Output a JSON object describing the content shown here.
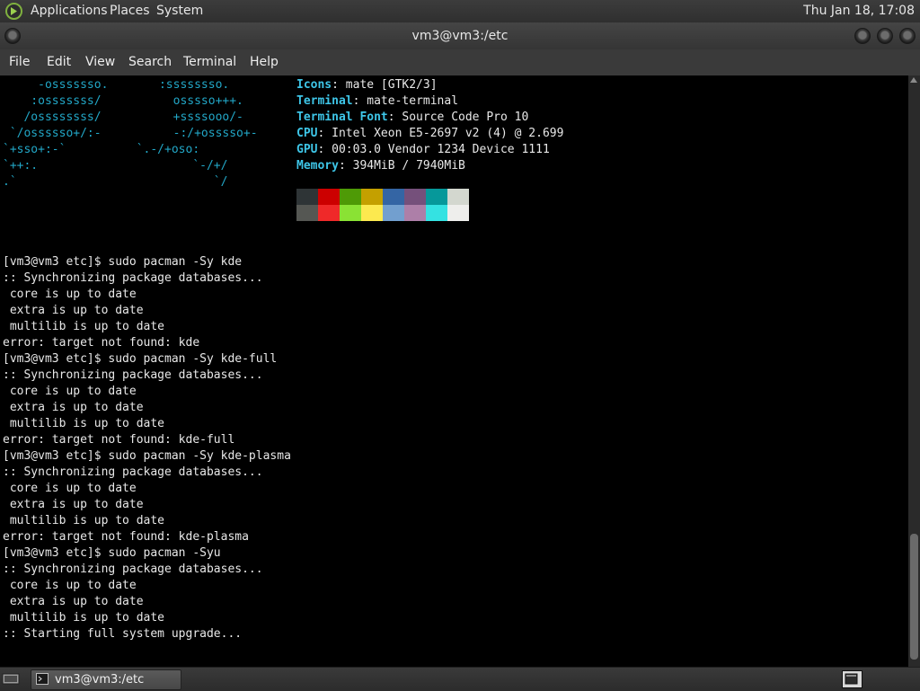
{
  "top_panel": {
    "menus": [
      "Applications",
      "Places",
      "System"
    ],
    "clock": "Thu Jan 18, 17:08"
  },
  "window": {
    "title": "vm3@vm3:/etc"
  },
  "menubar": {
    "items": [
      "File",
      "Edit",
      "View",
      "Search",
      "Terminal",
      "Help"
    ]
  },
  "terminal": {
    "ascii_art": [
      [
        "     -osssssso.",
        "      :ssssssso.  "
      ],
      [
        "    :osssssss/",
        "        osssso+++."
      ],
      [
        "   /ossssssss/",
        "        +ssssooo/-"
      ],
      [
        " `/ossssso+/:-",
        "        -:/+osssso+-"
      ],
      [
        "`+sso+:-`",
        "                   `.-/+oso:"
      ],
      [
        "`++:.",
        "                           `-/+/"
      ],
      [
        ".`",
        "                              `/"
      ]
    ],
    "info": [
      {
        "key": "Icons",
        "value": " mate [GTK2/3]"
      },
      {
        "key": "Terminal",
        "value": " mate-terminal"
      },
      {
        "key": "Terminal Font",
        "value": " Source Code Pro 10"
      },
      {
        "key": "CPU",
        "value": " Intel Xeon E5-2697 v2 (4) @ 2.699"
      },
      {
        "key": "GPU",
        "value": " 00:03.0 Vendor 1234 Device 1111"
      },
      {
        "key": "Memory",
        "value": " 394MiB / 7940MiB"
      }
    ],
    "palette_dark": [
      "#2e3436",
      "#cc0000",
      "#4e9a06",
      "#c4a000",
      "#3465a4",
      "#75507b",
      "#06989a",
      "#d3d7cf"
    ],
    "palette_bright": [
      "#555753",
      "#ef2929",
      "#8ae234",
      "#fce94f",
      "#729fcf",
      "#ad7fa8",
      "#34e2e2",
      "#eeeeec"
    ],
    "lines": [
      "[vm3@vm3 etc]$ sudo pacman -Sy kde",
      ":: Synchronizing package databases...",
      " core is up to date",
      " extra is up to date",
      " multilib is up to date",
      "error: target not found: kde",
      "[vm3@vm3 etc]$ sudo pacman -Sy kde-full",
      ":: Synchronizing package databases...",
      " core is up to date",
      " extra is up to date",
      " multilib is up to date",
      "error: target not found: kde-full",
      "[vm3@vm3 etc]$ sudo pacman -Sy kde-plasma",
      ":: Synchronizing package databases...",
      " core is up to date",
      " extra is up to date",
      " multilib is up to date",
      "error: target not found: kde-plasma",
      "[vm3@vm3 etc]$ sudo pacman -Syu",
      ":: Synchronizing package databases...",
      " core is up to date",
      " extra is up to date",
      " multilib is up to date",
      ":: Starting full system upgrade..."
    ]
  },
  "taskbar": {
    "task_label": "vm3@vm3:/etc"
  },
  "icons": {
    "distro_logo": "mate-logo-icon",
    "show_desktop": "show-desktop-icon",
    "terminal": "terminal-icon",
    "workspace": "workspace-switcher-icon"
  }
}
